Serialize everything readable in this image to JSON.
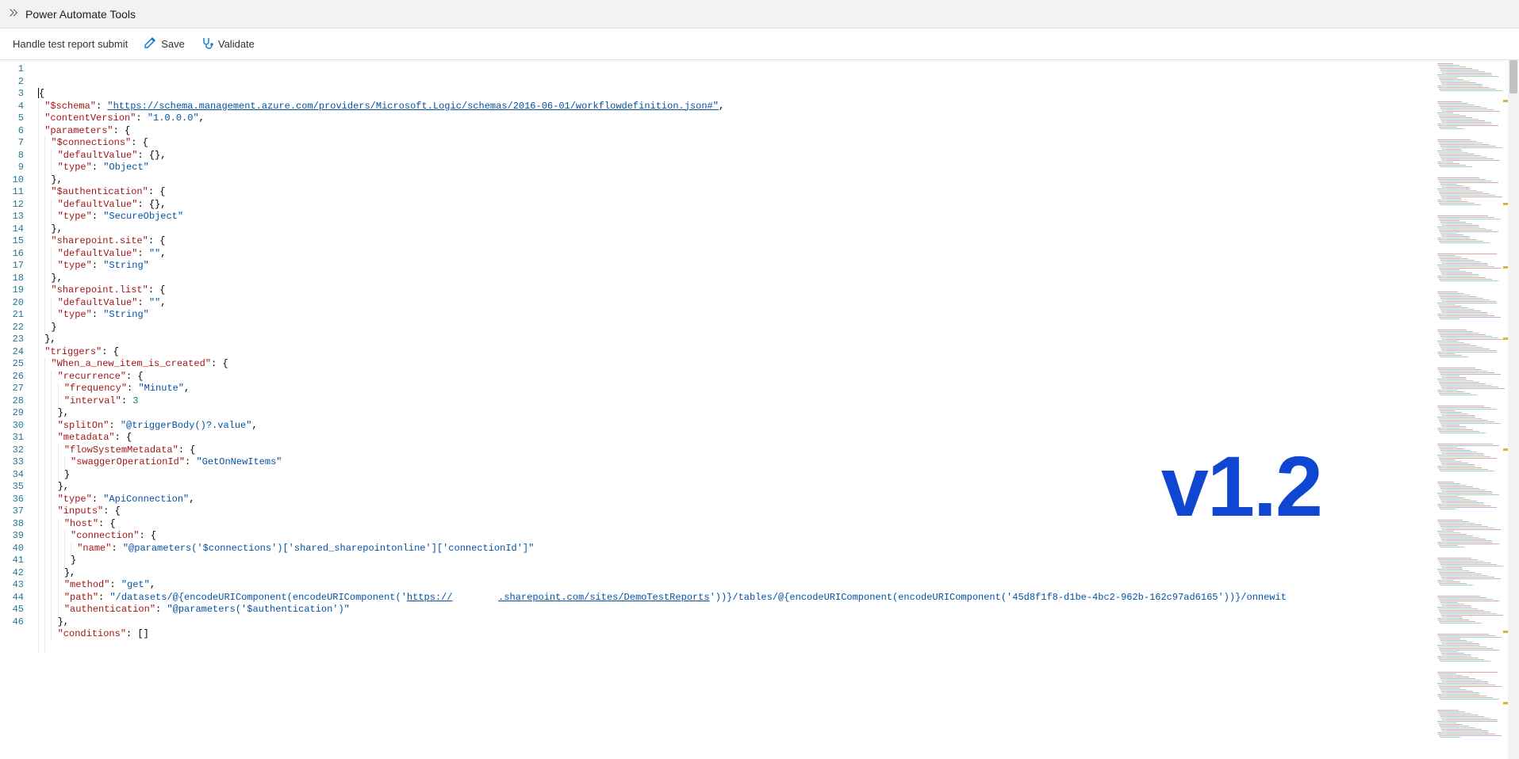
{
  "window": {
    "title": "Power Automate Tools"
  },
  "toolbar": {
    "flow_name": "Handle test report submit",
    "save_label": "Save",
    "validate_label": "Validate"
  },
  "overlay": {
    "version_text": "v1.2"
  },
  "colors": {
    "key": "#a31515",
    "string": "#0451a5",
    "number": "#098658",
    "accent": "#0078d4",
    "version": "#1047d2"
  },
  "code_lines": [
    {
      "n": "1",
      "tok": [
        {
          "c": "t-p",
          "t": "{"
        }
      ]
    },
    {
      "n": "2",
      "ind": 1,
      "tok": [
        {
          "c": "t-k",
          "t": "\"$schema\""
        },
        {
          "c": "t-p",
          "t": ": "
        },
        {
          "c": "t-l",
          "t": "\"https://schema.management.azure.com/providers/Microsoft.Logic/schemas/2016-06-01/workflowdefinition.json#\""
        },
        {
          "c": "t-p",
          "t": ","
        }
      ]
    },
    {
      "n": "3",
      "ind": 1,
      "tok": [
        {
          "c": "t-k",
          "t": "\"contentVersion\""
        },
        {
          "c": "t-p",
          "t": ": "
        },
        {
          "c": "t-s",
          "t": "\"1.0.0.0\""
        },
        {
          "c": "t-p",
          "t": ","
        }
      ]
    },
    {
      "n": "4",
      "ind": 1,
      "tok": [
        {
          "c": "t-k",
          "t": "\"parameters\""
        },
        {
          "c": "t-p",
          "t": ": {"
        }
      ]
    },
    {
      "n": "5",
      "ind": 2,
      "tok": [
        {
          "c": "t-k",
          "t": "\"$connections\""
        },
        {
          "c": "t-p",
          "t": ": {"
        }
      ]
    },
    {
      "n": "6",
      "ind": 3,
      "tok": [
        {
          "c": "t-k",
          "t": "\"defaultValue\""
        },
        {
          "c": "t-p",
          "t": ": {},"
        }
      ]
    },
    {
      "n": "7",
      "ind": 3,
      "tok": [
        {
          "c": "t-k",
          "t": "\"type\""
        },
        {
          "c": "t-p",
          "t": ": "
        },
        {
          "c": "t-s",
          "t": "\"Object\""
        }
      ]
    },
    {
      "n": "8",
      "ind": 2,
      "tok": [
        {
          "c": "t-p",
          "t": "},"
        }
      ]
    },
    {
      "n": "9",
      "ind": 2,
      "tok": [
        {
          "c": "t-k",
          "t": "\"$authentication\""
        },
        {
          "c": "t-p",
          "t": ": {"
        }
      ]
    },
    {
      "n": "10",
      "ind": 3,
      "tok": [
        {
          "c": "t-k",
          "t": "\"defaultValue\""
        },
        {
          "c": "t-p",
          "t": ": {},"
        }
      ]
    },
    {
      "n": "11",
      "ind": 3,
      "tok": [
        {
          "c": "t-k",
          "t": "\"type\""
        },
        {
          "c": "t-p",
          "t": ": "
        },
        {
          "c": "t-s",
          "t": "\"SecureObject\""
        }
      ]
    },
    {
      "n": "12",
      "ind": 2,
      "tok": [
        {
          "c": "t-p",
          "t": "},"
        }
      ]
    },
    {
      "n": "13",
      "ind": 2,
      "tok": [
        {
          "c": "t-k",
          "t": "\"sharepoint.site\""
        },
        {
          "c": "t-p",
          "t": ": {"
        }
      ]
    },
    {
      "n": "14",
      "ind": 3,
      "tok": [
        {
          "c": "t-k",
          "t": "\"defaultValue\""
        },
        {
          "c": "t-p",
          "t": ": "
        },
        {
          "c": "t-s",
          "t": "\"\""
        },
        {
          "c": "t-p",
          "t": ","
        }
      ]
    },
    {
      "n": "15",
      "ind": 3,
      "tok": [
        {
          "c": "t-k",
          "t": "\"type\""
        },
        {
          "c": "t-p",
          "t": ": "
        },
        {
          "c": "t-s",
          "t": "\"String\""
        }
      ]
    },
    {
      "n": "16",
      "ind": 2,
      "tok": [
        {
          "c": "t-p",
          "t": "},"
        }
      ]
    },
    {
      "n": "17",
      "ind": 2,
      "tok": [
        {
          "c": "t-k",
          "t": "\"sharepoint.list\""
        },
        {
          "c": "t-p",
          "t": ": {"
        }
      ]
    },
    {
      "n": "18",
      "ind": 3,
      "tok": [
        {
          "c": "t-k",
          "t": "\"defaultValue\""
        },
        {
          "c": "t-p",
          "t": ": "
        },
        {
          "c": "t-s",
          "t": "\"\""
        },
        {
          "c": "t-p",
          "t": ","
        }
      ]
    },
    {
      "n": "19",
      "ind": 3,
      "tok": [
        {
          "c": "t-k",
          "t": "\"type\""
        },
        {
          "c": "t-p",
          "t": ": "
        },
        {
          "c": "t-s",
          "t": "\"String\""
        }
      ]
    },
    {
      "n": "20",
      "ind": 2,
      "tok": [
        {
          "c": "t-p",
          "t": "}"
        }
      ]
    },
    {
      "n": "21",
      "ind": 1,
      "tok": [
        {
          "c": "t-p",
          "t": "},"
        }
      ]
    },
    {
      "n": "22",
      "ind": 1,
      "tok": [
        {
          "c": "t-k",
          "t": "\"triggers\""
        },
        {
          "c": "t-p",
          "t": ": {"
        }
      ]
    },
    {
      "n": "23",
      "ind": 2,
      "tok": [
        {
          "c": "t-k",
          "t": "\"When_a_new_item_is_created\""
        },
        {
          "c": "t-p",
          "t": ": {"
        }
      ]
    },
    {
      "n": "24",
      "ind": 3,
      "tok": [
        {
          "c": "t-k",
          "t": "\"recurrence\""
        },
        {
          "c": "t-p",
          "t": ": {"
        }
      ]
    },
    {
      "n": "25",
      "ind": 4,
      "tok": [
        {
          "c": "t-k",
          "t": "\"frequency\""
        },
        {
          "c": "t-p",
          "t": ": "
        },
        {
          "c": "t-s",
          "t": "\"Minute\""
        },
        {
          "c": "t-p",
          "t": ","
        }
      ]
    },
    {
      "n": "26",
      "ind": 4,
      "tok": [
        {
          "c": "t-k",
          "t": "\"interval\""
        },
        {
          "c": "t-p",
          "t": ": "
        },
        {
          "c": "t-n",
          "t": "3"
        }
      ]
    },
    {
      "n": "27",
      "ind": 3,
      "tok": [
        {
          "c": "t-p",
          "t": "},"
        }
      ]
    },
    {
      "n": "28",
      "ind": 3,
      "tok": [
        {
          "c": "t-k",
          "t": "\"splitOn\""
        },
        {
          "c": "t-p",
          "t": ": "
        },
        {
          "c": "t-s",
          "t": "\"@triggerBody()?.value\""
        },
        {
          "c": "t-p",
          "t": ","
        }
      ]
    },
    {
      "n": "29",
      "ind": 3,
      "tok": [
        {
          "c": "t-k",
          "t": "\"metadata\""
        },
        {
          "c": "t-p",
          "t": ": {"
        }
      ]
    },
    {
      "n": "30",
      "ind": 4,
      "tok": [
        {
          "c": "t-k",
          "t": "\"flowSystemMetadata\""
        },
        {
          "c": "t-p",
          "t": ": {"
        }
      ]
    },
    {
      "n": "31",
      "ind": 5,
      "tok": [
        {
          "c": "t-k",
          "t": "\"swaggerOperationId\""
        },
        {
          "c": "t-p",
          "t": ": "
        },
        {
          "c": "t-s",
          "t": "\"GetOnNewItems\""
        }
      ]
    },
    {
      "n": "32",
      "ind": 4,
      "tok": [
        {
          "c": "t-p",
          "t": "}"
        }
      ]
    },
    {
      "n": "33",
      "ind": 3,
      "tok": [
        {
          "c": "t-p",
          "t": "},"
        }
      ]
    },
    {
      "n": "34",
      "ind": 3,
      "tok": [
        {
          "c": "t-k",
          "t": "\"type\""
        },
        {
          "c": "t-p",
          "t": ": "
        },
        {
          "c": "t-s",
          "t": "\"ApiConnection\""
        },
        {
          "c": "t-p",
          "t": ","
        }
      ]
    },
    {
      "n": "35",
      "ind": 3,
      "tok": [
        {
          "c": "t-k",
          "t": "\"inputs\""
        },
        {
          "c": "t-p",
          "t": ": {"
        }
      ]
    },
    {
      "n": "36",
      "ind": 4,
      "tok": [
        {
          "c": "t-k",
          "t": "\"host\""
        },
        {
          "c": "t-p",
          "t": ": {"
        }
      ]
    },
    {
      "n": "37",
      "ind": 5,
      "tok": [
        {
          "c": "t-k",
          "t": "\"connection\""
        },
        {
          "c": "t-p",
          "t": ": {"
        }
      ]
    },
    {
      "n": "38",
      "ind": 6,
      "tok": [
        {
          "c": "t-k",
          "t": "\"name\""
        },
        {
          "c": "t-p",
          "t": ": "
        },
        {
          "c": "t-s",
          "t": "\"@parameters('$connections')['shared_sharepointonline']['connectionId']\""
        }
      ]
    },
    {
      "n": "39",
      "ind": 5,
      "tok": [
        {
          "c": "t-p",
          "t": "}"
        }
      ]
    },
    {
      "n": "40",
      "ind": 4,
      "tok": [
        {
          "c": "t-p",
          "t": "},"
        }
      ]
    },
    {
      "n": "41",
      "ind": 4,
      "tok": [
        {
          "c": "t-k",
          "t": "\"method\""
        },
        {
          "c": "t-p",
          "t": ": "
        },
        {
          "c": "t-s",
          "t": "\"get\""
        },
        {
          "c": "t-p",
          "t": ","
        }
      ]
    },
    {
      "n": "42",
      "ind": 4,
      "tok": [
        {
          "c": "t-k",
          "t": "\"path\""
        },
        {
          "c": "t-p",
          "t": ": "
        },
        {
          "c": "t-s",
          "t": "\"/datasets/@{encodeURIComponent(encodeURIComponent('"
        },
        {
          "c": "t-l",
          "t": "https://"
        },
        {
          "c": "t-s",
          "t": "        "
        },
        {
          "c": "t-l",
          "t": ".sharepoint.com/sites/DemoTestReports"
        },
        {
          "c": "t-s",
          "t": "'))}/tables/@{encodeURIComponent(encodeURIComponent('45d8f1f8-d1be-4bc2-962b-162c97ad6165'))}/onnewit"
        }
      ]
    },
    {
      "n": "43",
      "ind": 4,
      "tok": [
        {
          "c": "t-k",
          "t": "\"authentication\""
        },
        {
          "c": "t-p",
          "t": ": "
        },
        {
          "c": "t-s",
          "t": "\"@parameters('$authentication')\""
        }
      ]
    },
    {
      "n": "44",
      "ind": 3,
      "tok": [
        {
          "c": "t-p",
          "t": "},"
        }
      ]
    },
    {
      "n": "45",
      "ind": 3,
      "tok": [
        {
          "c": "t-k",
          "t": "\"conditions\""
        },
        {
          "c": "t-p",
          "t": ": []"
        }
      ]
    },
    {
      "n": "46",
      "ind": 2,
      "tok": []
    }
  ]
}
